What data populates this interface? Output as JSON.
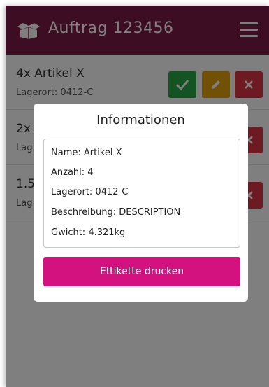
{
  "navbar": {
    "title": "Auftrag 123456",
    "logo_icon": "box-open-icon",
    "menu_icon": "hamburger-menu-icon",
    "color": "#7b1b48"
  },
  "items": [
    {
      "title": "4x Artikel X",
      "location": "Lagerort: 0412-C"
    },
    {
      "title": "2x",
      "location": "Lag"
    },
    {
      "title": "1.5",
      "location": "Lag"
    }
  ],
  "actions": {
    "confirm_icon": "check-icon",
    "edit_icon": "pencil-icon",
    "delete_icon": "close-icon",
    "confirm_color": "#28a745",
    "edit_color": "#e0a30b",
    "delete_color": "#dc3545"
  },
  "modal": {
    "title": "Informationen",
    "fields": {
      "name": "Name: Artikel X",
      "quantity": "Anzahl: 4",
      "location": "Lagerort: 0412-C",
      "description": "Beschreibung: DESCRIPTION",
      "weight": "Gwicht: 4.321kg"
    },
    "print_label": "Ettikette drucken",
    "print_color": "#d4127f"
  }
}
